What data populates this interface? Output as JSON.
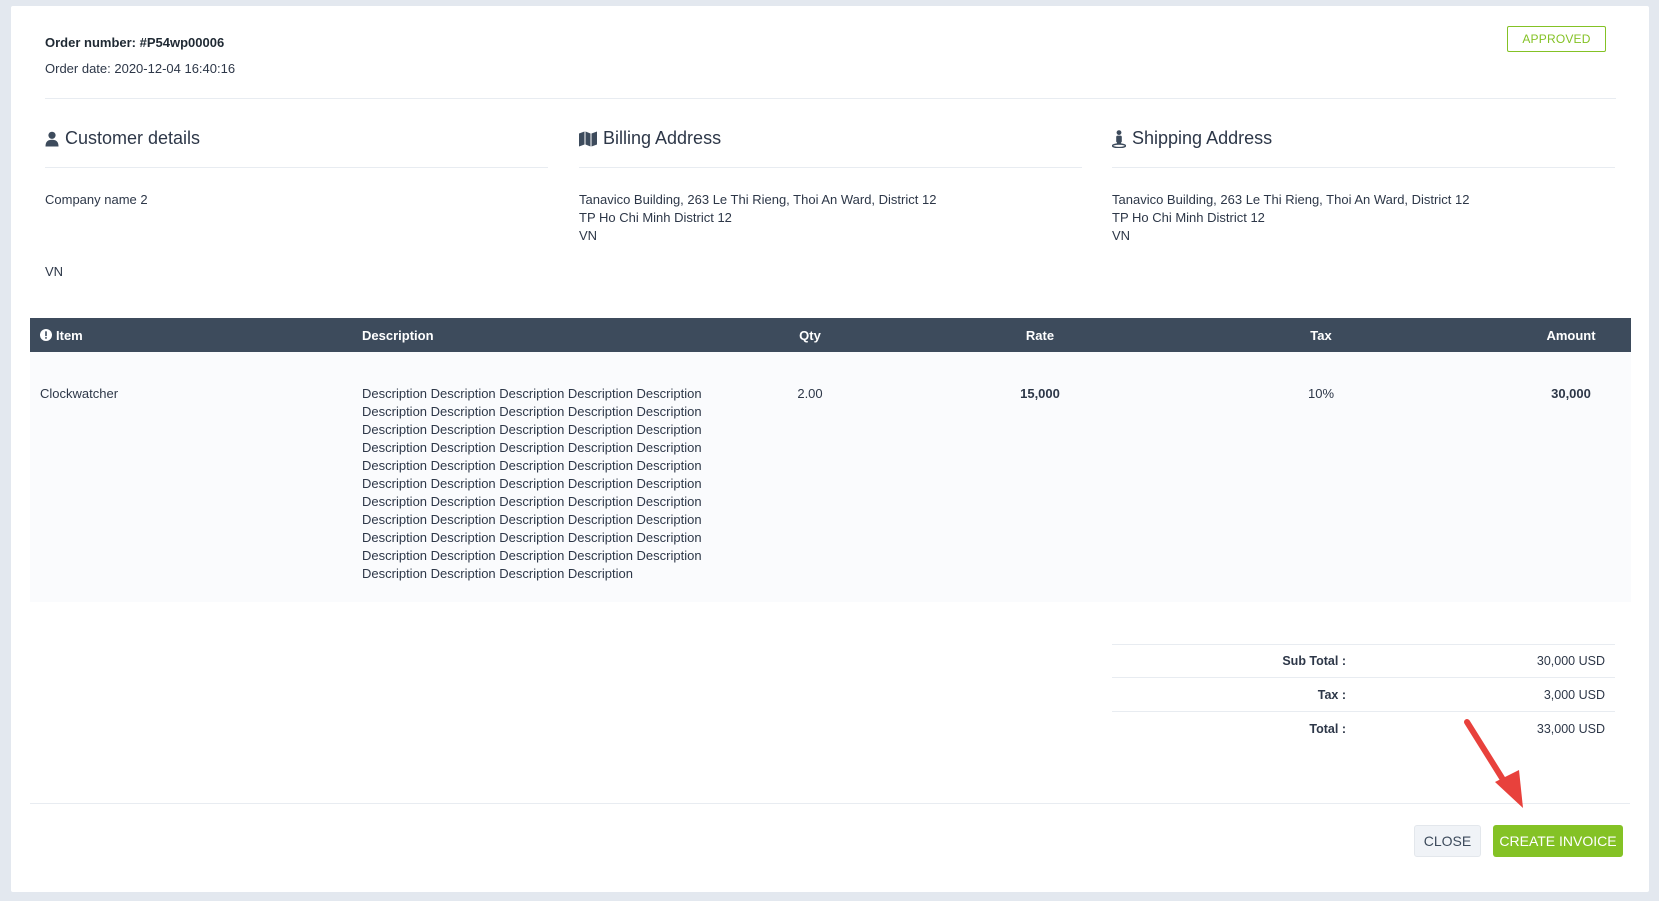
{
  "order": {
    "number_label": "Order number: #P54wp00006",
    "date_label": "Order date: 2020-12-04 16:40:16",
    "status": "APPROVED"
  },
  "customer": {
    "heading": "Customer details",
    "company": "Company name 2",
    "country": "VN"
  },
  "billing": {
    "heading": "Billing Address",
    "line1": "Tanavico Building, 263 Le Thi Rieng, Thoi An Ward, District 12",
    "line2": "TP Ho Chi Minh District 12",
    "line3": "VN"
  },
  "shipping": {
    "heading": "Shipping Address",
    "line1": "Tanavico Building, 263 Le Thi Rieng, Thoi An Ward, District 12",
    "line2": "TP Ho Chi Minh District 12",
    "line3": "VN"
  },
  "table": {
    "headers": {
      "item": "Item",
      "description": "Description",
      "qty": "Qty",
      "rate": "Rate",
      "tax": "Tax",
      "amount": "Amount"
    },
    "rows": [
      {
        "item": "Clockwatcher",
        "description": "Description Description Description Description Description Description Description Description Description Description Description Description Description Description Description Description Description Description Description Description Description Description Description Description Description Description Description Description Description Description Description Description Description Description Description Description Description Description Description Description Description Description Description Description Description Description Description Description Description Description Description Description Description Description",
        "qty": "2.00",
        "rate": "15,000",
        "tax": "10%",
        "amount": "30,000"
      }
    ]
  },
  "totals": {
    "subtotal_label": "Sub Total :",
    "subtotal_value": "30,000 USD",
    "tax_label": "Tax :",
    "tax_value": "3,000 USD",
    "total_label": "Total :",
    "total_value": "33,000 USD"
  },
  "footer": {
    "close_label": "CLOSE",
    "create_label": "CREATE INVOICE"
  },
  "colors": {
    "accent": "#84c225",
    "header_bg": "#3d4b5c",
    "annotation_arrow": "#e8413c"
  }
}
